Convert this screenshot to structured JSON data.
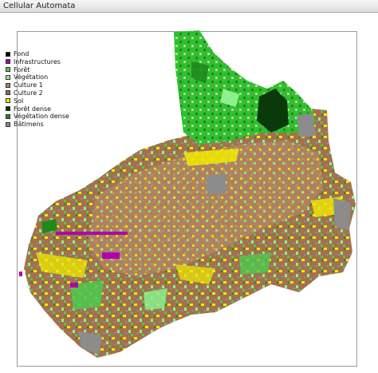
{
  "window": {
    "title": "Cellular Automata"
  },
  "legend": {
    "items": [
      {
        "label": "Fond",
        "color": "#000000"
      },
      {
        "label": "Infrastructures",
        "color": "#b000b0"
      },
      {
        "label": "Forêt",
        "color": "#4ec94e"
      },
      {
        "label": "Végétation",
        "color": "#8cf08c"
      },
      {
        "label": "Culture 1",
        "color": "#b08060"
      },
      {
        "label": "Culture 2",
        "color": "#9a6a4c"
      },
      {
        "label": "Sol",
        "color": "#f2ea00"
      },
      {
        "label": "Forêt dense",
        "color": "#0a2e0a"
      },
      {
        "label": "Végétation dense",
        "color": "#1e8a1e"
      },
      {
        "label": "Bâtimens",
        "color": "#8c8c8c"
      }
    ]
  }
}
